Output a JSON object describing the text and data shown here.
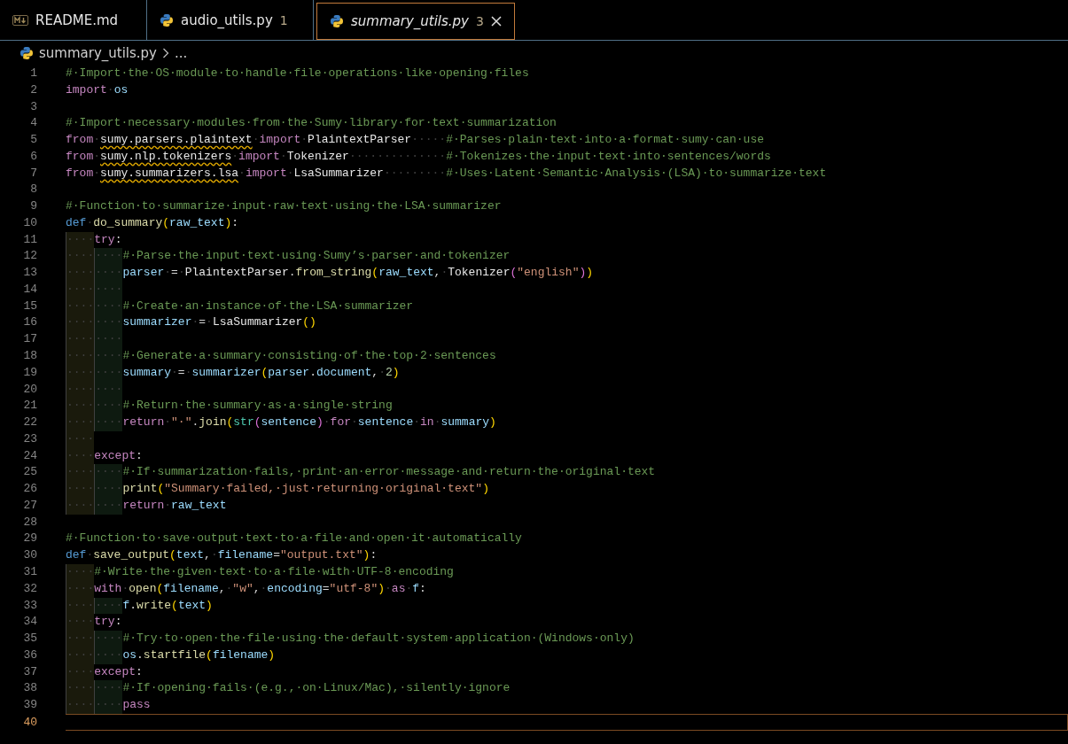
{
  "tabs": [
    {
      "label": "README.md",
      "kind": "markdown",
      "selected": false,
      "preview": false
    },
    {
      "label": "audio_utils.py",
      "kind": "python",
      "badge": "1",
      "selected": false,
      "preview": false
    },
    {
      "label": "summary_utils.py",
      "kind": "python",
      "badge": "3",
      "selected": true,
      "preview": true
    }
  ],
  "breadcrumb": {
    "file": "summary_utils.py",
    "kind": "python",
    "more": "..."
  },
  "lines": [
    {
      "n": "1",
      "current": false,
      "tokens": [
        {
          "text": "#·Import·the·OS·module·to·handle·file·operations·like·opening·files",
          "kind": "comment"
        }
      ]
    },
    {
      "n": "2",
      "current": false,
      "tokens": [
        {
          "text": "import",
          "kind": "keyword"
        },
        {
          "text": "·",
          "kind": "space"
        },
        {
          "text": "os",
          "kind": "variable"
        }
      ]
    },
    {
      "n": "3",
      "current": false
    },
    {
      "n": "4",
      "current": false,
      "tokens": [
        {
          "text": "#·Import·necessary·modules·from·the·Sumy·library·for·text·summarization",
          "kind": "comment"
        }
      ]
    },
    {
      "n": "5",
      "current": false,
      "tokens": [
        {
          "text": "from",
          "kind": "keyword"
        },
        {
          "text": "·",
          "kind": "space"
        },
        {
          "text": "sumy.parsers.plaintext",
          "kind": "unresolved"
        },
        {
          "text": "·",
          "kind": "space"
        },
        {
          "text": "import",
          "kind": "keyword"
        },
        {
          "text": "·",
          "kind": "space"
        },
        {
          "text": "PlaintextParser",
          "kind": "class"
        },
        {
          "text": "·····",
          "kind": "space"
        },
        {
          "text": "#·Parses·plain·text·into·a·format·sumy·can·use",
          "kind": "comment"
        }
      ]
    },
    {
      "n": "6",
      "current": false,
      "tokens": [
        {
          "text": "from",
          "kind": "keyword"
        },
        {
          "text": "·",
          "kind": "space"
        },
        {
          "text": "sumy.nlp.tokenizers",
          "kind": "unresolved"
        },
        {
          "text": "·",
          "kind": "space"
        },
        {
          "text": "import",
          "kind": "keyword"
        },
        {
          "text": "·",
          "kind": "space"
        },
        {
          "text": "Tokenizer",
          "kind": "class"
        },
        {
          "text": "··············",
          "kind": "space"
        },
        {
          "text": "#·Tokenizes·the·input·text·into·sentences/words",
          "kind": "comment"
        }
      ]
    },
    {
      "n": "7",
      "current": false,
      "tokens": [
        {
          "text": "from",
          "kind": "keyword"
        },
        {
          "text": "·",
          "kind": "space"
        },
        {
          "text": "sumy.summarizers.lsa",
          "kind": "unresolved"
        },
        {
          "text": "·",
          "kind": "space"
        },
        {
          "text": "import",
          "kind": "keyword"
        },
        {
          "text": "·",
          "kind": "space"
        },
        {
          "text": "LsaSummarizer",
          "kind": "class"
        },
        {
          "text": "·········",
          "kind": "space"
        },
        {
          "text": "#·Uses·Latent·Semantic·Analysis·(LSA)·to·summarize·text",
          "kind": "comment"
        }
      ]
    },
    {
      "n": "8",
      "current": false
    },
    {
      "n": "9",
      "current": false,
      "tokens": [
        {
          "text": "#·Function·to·summarize·input·raw·text·using·the·LSA·summarizer",
          "kind": "comment"
        }
      ]
    },
    {
      "n": "10",
      "current": false,
      "tokens": [
        {
          "text": "def",
          "kind": "def"
        },
        {
          "text": "·",
          "kind": "space"
        },
        {
          "text": "do_summary",
          "kind": "function"
        },
        {
          "text": "(",
          "kind": "bracket"
        },
        {
          "text": "raw_text",
          "kind": "variable"
        },
        {
          "text": ")",
          "kind": "bracket"
        },
        {
          "text": ":",
          "kind": "punct"
        }
      ]
    },
    {
      "n": "11",
      "current": false,
      "tokens": [
        {
          "text": "····",
          "kind": "indent"
        },
        {
          "text": "try",
          "kind": "keyword"
        },
        {
          "text": ":",
          "kind": "punct"
        }
      ]
    },
    {
      "n": "12",
      "current": false,
      "tokens": [
        {
          "text": "········",
          "kind": "indent"
        },
        {
          "text": "#·Parse·the·input·text·using·Sumy’s·parser·and·tokenizer",
          "kind": "comment"
        }
      ]
    },
    {
      "n": "13",
      "current": false,
      "tokens": [
        {
          "text": "········",
          "kind": "indent"
        },
        {
          "text": "parser",
          "kind": "variable"
        },
        {
          "text": "·",
          "kind": "space"
        },
        {
          "text": "=",
          "kind": "punct"
        },
        {
          "text": "·",
          "kind": "space"
        },
        {
          "text": "PlaintextParser",
          "kind": "class"
        },
        {
          "text": ".",
          "kind": "punct"
        },
        {
          "text": "from_string",
          "kind": "function"
        },
        {
          "text": "(",
          "kind": "bracket"
        },
        {
          "text": "raw_text",
          "kind": "variable"
        },
        {
          "text": ",",
          "kind": "punct"
        },
        {
          "text": "·",
          "kind": "space"
        },
        {
          "text": "Tokenizer",
          "kind": "class"
        },
        {
          "text": "(",
          "kind": "bracket2"
        },
        {
          "text": "\"english\"",
          "kind": "string"
        },
        {
          "text": ")",
          "kind": "bracket2"
        },
        {
          "text": ")",
          "kind": "bracket"
        }
      ]
    },
    {
      "n": "14",
      "current": false,
      "tokens": [
        {
          "text": "········",
          "kind": "indent"
        }
      ]
    },
    {
      "n": "15",
      "current": false,
      "tokens": [
        {
          "text": "········",
          "kind": "indent"
        },
        {
          "text": "#·Create·an·instance·of·the·LSA·summarizer",
          "kind": "comment"
        }
      ]
    },
    {
      "n": "16",
      "current": false,
      "tokens": [
        {
          "text": "········",
          "kind": "indent"
        },
        {
          "text": "summarizer",
          "kind": "variable"
        },
        {
          "text": "·",
          "kind": "space"
        },
        {
          "text": "=",
          "kind": "punct"
        },
        {
          "text": "·",
          "kind": "space"
        },
        {
          "text": "LsaSummarizer",
          "kind": "class"
        },
        {
          "text": "()",
          "kind": "bracket"
        }
      ]
    },
    {
      "n": "17",
      "current": false,
      "tokens": [
        {
          "text": "········",
          "kind": "indent"
        }
      ]
    },
    {
      "n": "18",
      "current": false,
      "tokens": [
        {
          "text": "········",
          "kind": "indent"
        },
        {
          "text": "#·Generate·a·summary·consisting·of·the·top·2·sentences",
          "kind": "comment"
        }
      ]
    },
    {
      "n": "19",
      "current": false,
      "tokens": [
        {
          "text": "········",
          "kind": "indent"
        },
        {
          "text": "summary",
          "kind": "variable"
        },
        {
          "text": "·",
          "kind": "space"
        },
        {
          "text": "=",
          "kind": "punct"
        },
        {
          "text": "·",
          "kind": "space"
        },
        {
          "text": "summarizer",
          "kind": "variable"
        },
        {
          "text": "(",
          "kind": "bracket"
        },
        {
          "text": "parser",
          "kind": "variable"
        },
        {
          "text": ".",
          "kind": "punct"
        },
        {
          "text": "document",
          "kind": "variable"
        },
        {
          "text": ",",
          "kind": "punct"
        },
        {
          "text": "·",
          "kind": "space"
        },
        {
          "text": "2",
          "kind": "number"
        },
        {
          "text": ")",
          "kind": "bracket"
        }
      ]
    },
    {
      "n": "20",
      "current": false,
      "tokens": [
        {
          "text": "········",
          "kind": "indent"
        }
      ]
    },
    {
      "n": "21",
      "current": false,
      "tokens": [
        {
          "text": "········",
          "kind": "indent"
        },
        {
          "text": "#·Return·the·summary·as·a·single·string",
          "kind": "comment"
        }
      ]
    },
    {
      "n": "22",
      "current": false,
      "tokens": [
        {
          "text": "········",
          "kind": "indent"
        },
        {
          "text": "return",
          "kind": "keyword"
        },
        {
          "text": "·",
          "kind": "space"
        },
        {
          "text": "\"·\"",
          "kind": "string"
        },
        {
          "text": ".",
          "kind": "punct"
        },
        {
          "text": "join",
          "kind": "function"
        },
        {
          "text": "(",
          "kind": "bracket"
        },
        {
          "text": "str",
          "kind": "type"
        },
        {
          "text": "(",
          "kind": "bracket2"
        },
        {
          "text": "sentence",
          "kind": "variable"
        },
        {
          "text": ")",
          "kind": "bracket2"
        },
        {
          "text": "·",
          "kind": "space"
        },
        {
          "text": "for",
          "kind": "keyword"
        },
        {
          "text": "·",
          "kind": "space"
        },
        {
          "text": "sentence",
          "kind": "variable"
        },
        {
          "text": "·",
          "kind": "space"
        },
        {
          "text": "in",
          "kind": "keyword"
        },
        {
          "text": "·",
          "kind": "space"
        },
        {
          "text": "summary",
          "kind": "variable"
        },
        {
          "text": ")",
          "kind": "bracket"
        }
      ]
    },
    {
      "n": "23",
      "current": false,
      "tokens": [
        {
          "text": "····",
          "kind": "indent"
        }
      ]
    },
    {
      "n": "24",
      "current": false,
      "tokens": [
        {
          "text": "····",
          "kind": "indent"
        },
        {
          "text": "except",
          "kind": "keyword"
        },
        {
          "text": ":",
          "kind": "punct"
        }
      ]
    },
    {
      "n": "25",
      "current": false,
      "tokens": [
        {
          "text": "········",
          "kind": "indent"
        },
        {
          "text": "#·If·summarization·fails,·print·an·error·message·and·return·the·original·text",
          "kind": "comment"
        }
      ]
    },
    {
      "n": "26",
      "current": false,
      "tokens": [
        {
          "text": "········",
          "kind": "indent"
        },
        {
          "text": "print",
          "kind": "function"
        },
        {
          "text": "(",
          "kind": "bracket"
        },
        {
          "text": "\"Summary·failed,·just·returning·original·text\"",
          "kind": "string"
        },
        {
          "text": ")",
          "kind": "bracket"
        }
      ]
    },
    {
      "n": "27",
      "current": false,
      "tokens": [
        {
          "text": "········",
          "kind": "indent"
        },
        {
          "text": "return",
          "kind": "keyword"
        },
        {
          "text": "·",
          "kind": "space"
        },
        {
          "text": "raw_text",
          "kind": "variable"
        }
      ]
    },
    {
      "n": "28",
      "current": false
    },
    {
      "n": "29",
      "current": false,
      "tokens": [
        {
          "text": "#·Function·to·save·output·text·to·a·file·and·open·it·automatically",
          "kind": "comment"
        }
      ]
    },
    {
      "n": "30",
      "current": false,
      "tokens": [
        {
          "text": "def",
          "kind": "def"
        },
        {
          "text": "·",
          "kind": "space"
        },
        {
          "text": "save_output",
          "kind": "function"
        },
        {
          "text": "(",
          "kind": "bracket"
        },
        {
          "text": "text",
          "kind": "variable"
        },
        {
          "text": ",",
          "kind": "punct"
        },
        {
          "text": "·",
          "kind": "space"
        },
        {
          "text": "filename",
          "kind": "variable"
        },
        {
          "text": "=",
          "kind": "punct"
        },
        {
          "text": "\"output.txt\"",
          "kind": "string"
        },
        {
          "text": ")",
          "kind": "bracket"
        },
        {
          "text": ":",
          "kind": "punct"
        }
      ]
    },
    {
      "n": "31",
      "current": false,
      "tokens": [
        {
          "text": "····",
          "kind": "indent"
        },
        {
          "text": "#·Write·the·given·text·to·a·file·with·UTF-8·encoding",
          "kind": "comment"
        }
      ]
    },
    {
      "n": "32",
      "current": false,
      "tokens": [
        {
          "text": "····",
          "kind": "indent"
        },
        {
          "text": "with",
          "kind": "keyword"
        },
        {
          "text": "·",
          "kind": "space"
        },
        {
          "text": "open",
          "kind": "function"
        },
        {
          "text": "(",
          "kind": "bracket"
        },
        {
          "text": "filename",
          "kind": "variable"
        },
        {
          "text": ",",
          "kind": "punct"
        },
        {
          "text": "·",
          "kind": "space"
        },
        {
          "text": "\"w\"",
          "kind": "string"
        },
        {
          "text": ",",
          "kind": "punct"
        },
        {
          "text": "·",
          "kind": "space"
        },
        {
          "text": "encoding",
          "kind": "variable"
        },
        {
          "text": "=",
          "kind": "punct"
        },
        {
          "text": "\"utf-8\"",
          "kind": "string"
        },
        {
          "text": ")",
          "kind": "bracket"
        },
        {
          "text": "·",
          "kind": "space"
        },
        {
          "text": "as",
          "kind": "keyword"
        },
        {
          "text": "·",
          "kind": "space"
        },
        {
          "text": "f",
          "kind": "variable"
        },
        {
          "text": ":",
          "kind": "punct"
        }
      ]
    },
    {
      "n": "33",
      "current": false,
      "tokens": [
        {
          "text": "········",
          "kind": "indent"
        },
        {
          "text": "f",
          "kind": "variable"
        },
        {
          "text": ".",
          "kind": "punct"
        },
        {
          "text": "write",
          "kind": "function"
        },
        {
          "text": "(",
          "kind": "bracket"
        },
        {
          "text": "text",
          "kind": "variable"
        },
        {
          "text": ")",
          "kind": "bracket"
        }
      ]
    },
    {
      "n": "34",
      "current": false,
      "tokens": [
        {
          "text": "····",
          "kind": "indent"
        },
        {
          "text": "try",
          "kind": "keyword"
        },
        {
          "text": ":",
          "kind": "punct"
        }
      ]
    },
    {
      "n": "35",
      "current": false,
      "tokens": [
        {
          "text": "········",
          "kind": "indent"
        },
        {
          "text": "#·Try·to·open·the·file·using·the·default·system·application·(Windows·only)",
          "kind": "comment"
        }
      ]
    },
    {
      "n": "36",
      "current": false,
      "tokens": [
        {
          "text": "········",
          "kind": "indent"
        },
        {
          "text": "os",
          "kind": "variable"
        },
        {
          "text": ".",
          "kind": "punct"
        },
        {
          "text": "startfile",
          "kind": "function"
        },
        {
          "text": "(",
          "kind": "bracket"
        },
        {
          "text": "filename",
          "kind": "variable"
        },
        {
          "text": ")",
          "kind": "bracket"
        }
      ]
    },
    {
      "n": "37",
      "current": false,
      "tokens": [
        {
          "text": "····",
          "kind": "indent"
        },
        {
          "text": "except",
          "kind": "keyword"
        },
        {
          "text": ":",
          "kind": "punct"
        }
      ]
    },
    {
      "n": "38",
      "current": false,
      "tokens": [
        {
          "text": "········",
          "kind": "indent"
        },
        {
          "text": "#·If·opening·fails·(e.g.,·on·Linux/Mac),·silently·ignore",
          "kind": "comment"
        }
      ]
    },
    {
      "n": "39",
      "current": false,
      "tokens": [
        {
          "text": "········",
          "kind": "indent"
        },
        {
          "text": "pass",
          "kind": "keyword"
        }
      ]
    },
    {
      "n": "40",
      "current": true
    }
  ]
}
